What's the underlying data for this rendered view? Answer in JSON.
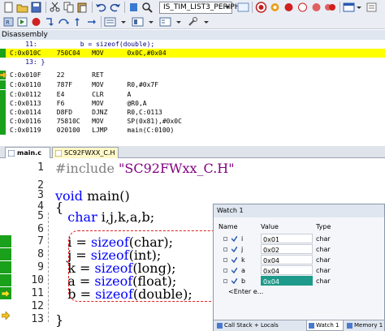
{
  "toolbar": {
    "target_name": "IS_TIM_LIST3_PERIPH"
  },
  "disassembly": {
    "title": "Disassembly",
    "lines": [
      {
        "text": "    11:           b = sizeof(double);",
        "kind": "src"
      },
      {
        "text": "C:0x010C    750C04   MOV      0x0C,#0x04",
        "kind": "hl"
      },
      {
        "text": "    13: }",
        "kind": "src"
      },
      {
        "text": "C:0x010F    22       RET",
        "kind": "asm"
      },
      {
        "text": "C:0x0110    787F     MOV      R0,#0x7F",
        "kind": "asm"
      },
      {
        "text": "C:0x0112    E4       CLR      A",
        "kind": "asm"
      },
      {
        "text": "C:0x0113    F6       MOV      @R0,A",
        "kind": "asm"
      },
      {
        "text": "C:0x0114    D8FD     DJNZ     R0,C:0113",
        "kind": "asm"
      },
      {
        "text": "C:0x0116    75810C   MOV      SP(0x81),#0x0C",
        "kind": "asm"
      },
      {
        "text": "C:0x0119    020100   LJMP     main(C:0100)",
        "kind": "asm"
      }
    ]
  },
  "tabs": [
    {
      "label": "main.c",
      "active": true
    },
    {
      "label": "SC92FWXX_C.H",
      "active": false
    }
  ],
  "editor": {
    "line_numbers": [
      "1",
      "2",
      "3",
      "4",
      "5",
      "6",
      "7",
      "8",
      "9",
      "10",
      "11",
      "12",
      "13"
    ],
    "lines": [
      {
        "parts": [
          {
            "t": "#include ",
            "c": "pp"
          },
          {
            "t": "\"SC92FWxx_C.H\"",
            "c": "str"
          }
        ]
      },
      {
        "parts": []
      },
      {
        "parts": [
          {
            "t": "void ",
            "c": "kw"
          },
          {
            "t": "main()",
            "c": "ws"
          }
        ]
      },
      {
        "parts": [
          {
            "t": "{",
            "c": "ws"
          }
        ]
      },
      {
        "parts": [
          {
            "t": "   char ",
            "c": "kw"
          },
          {
            "t": "i,j,k,a,b;",
            "c": "ws"
          }
        ]
      },
      {
        "parts": []
      },
      {
        "parts": [
          {
            "t": "   i = ",
            "c": "ws"
          },
          {
            "t": "sizeof",
            "c": "kw"
          },
          {
            "t": "(char);",
            "c": "ws"
          }
        ]
      },
      {
        "parts": [
          {
            "t": "   j = ",
            "c": "ws"
          },
          {
            "t": "sizeof",
            "c": "kw"
          },
          {
            "t": "(int);",
            "c": "ws"
          }
        ]
      },
      {
        "parts": [
          {
            "t": "   k = ",
            "c": "ws"
          },
          {
            "t": "sizeof",
            "c": "kw"
          },
          {
            "t": "(long);",
            "c": "ws"
          }
        ]
      },
      {
        "parts": [
          {
            "t": "   a = ",
            "c": "ws"
          },
          {
            "t": "sizeof",
            "c": "kw"
          },
          {
            "t": "(float);",
            "c": "ws"
          }
        ]
      },
      {
        "parts": [
          {
            "t": "   b = ",
            "c": "ws"
          },
          {
            "t": "sizeof",
            "c": "kw"
          },
          {
            "t": "(double);",
            "c": "ws"
          }
        ]
      },
      {
        "parts": []
      },
      {
        "parts": [
          {
            "t": "}",
            "c": "ws"
          }
        ]
      }
    ]
  },
  "watch": {
    "title": "Watch 1",
    "headers": {
      "name": "Name",
      "value": "Value",
      "type": "Type"
    },
    "rows": [
      {
        "name": "i",
        "value": "0x01",
        "type": "char",
        "selected": false
      },
      {
        "name": "j",
        "value": "0x02",
        "type": "char",
        "selected": false
      },
      {
        "name": "k",
        "value": "0x04",
        "type": "char",
        "selected": false
      },
      {
        "name": "a",
        "value": "0x04",
        "type": "char",
        "selected": false
      },
      {
        "name": "b",
        "value": "0x04",
        "type": "char",
        "selected": true
      }
    ],
    "enter_expr": "<Enter e...",
    "bottom_tabs": [
      {
        "label": "Call Stack + Locals",
        "active": false
      },
      {
        "label": "Watch 1",
        "active": true
      },
      {
        "label": "Memory 1",
        "active": false
      }
    ]
  },
  "colors": {
    "green_bar": "#1aa01a",
    "highlight": "#ffff00",
    "keyword": "#0000ff",
    "string": "#800080",
    "selection": "#1e9a8a",
    "annotation": "#e02020"
  }
}
